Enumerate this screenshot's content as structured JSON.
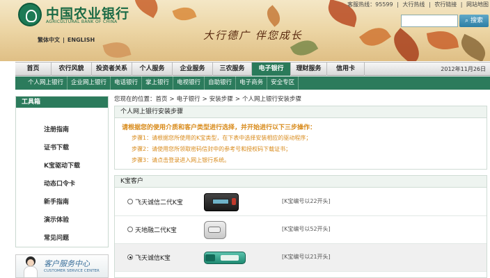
{
  "header": {
    "bank_name": "中国农业银行",
    "bank_name_en": "AGRICULTURAL BANK OF CHINA",
    "lang_cn": "繁体中文",
    "lang_sep": "|",
    "lang_en": "ENGLISH",
    "slogan": "大行德广  伴您成长",
    "top_links": [
      "客服热线：95599",
      "|",
      "大行热线",
      "|",
      "农行链接",
      "|",
      "网站地图"
    ],
    "search_placeholder": "",
    "search_button": "搜索"
  },
  "nav": {
    "items": [
      "首页",
      "农行风貌",
      "投资者关系",
      "个人服务",
      "企业服务",
      "三农服务",
      "电子银行",
      "理财服务",
      "信用卡"
    ],
    "active": "电子银行",
    "date": "2012年11月26日"
  },
  "subnav": {
    "items": [
      "个人网上银行",
      "企业网上银行",
      "电话银行",
      "掌上银行",
      "电视银行",
      "自助银行",
      "电子商务",
      "安全专区"
    ]
  },
  "toolbox": {
    "title": "工具箱",
    "items": [
      "注册指南",
      "证书下载",
      "K宝驱动下载",
      "动态口令卡",
      "新手指南",
      "演示体验",
      "常见问题"
    ]
  },
  "service_center": {
    "title_cn": "客户服务中心",
    "title_en": "CUSTOMER SERVICE CENTER"
  },
  "breadcrumb": {
    "prefix": "您现在的位置：",
    "items": [
      "首页",
      "电子银行",
      "安装步骤",
      "个人网上银行安装步骤"
    ],
    "sep": ">"
  },
  "install": {
    "title": "个人网上银行安装步骤",
    "instruction": "请根据您的使用介质和客户类型进行选择，并开始进行以下三步操作：",
    "steps": [
      "步骤1：请根据您所使用的K宝类型，在下表中选择安装相应的驱动程序；",
      "步骤2：请使用您所领取密码信封中的参考号和授权码下载证书；",
      "步骤3：请点击登录进入网上银行系统。"
    ]
  },
  "ukey": {
    "title": "K宝客户",
    "rows": [
      {
        "name": "飞天诚信二代K宝",
        "desc": "[K宝编号以22开头]",
        "selected": false
      },
      {
        "name": "天地融二代K宝",
        "desc": "[K宝编号以52开头]",
        "selected": false
      },
      {
        "name": "飞天诚信K宝",
        "desc": "[K宝编号以21开头]",
        "selected": true
      }
    ]
  },
  "colors": {
    "brand_green": "#2c7b5c",
    "instruction_orange": "#d88a1a"
  }
}
